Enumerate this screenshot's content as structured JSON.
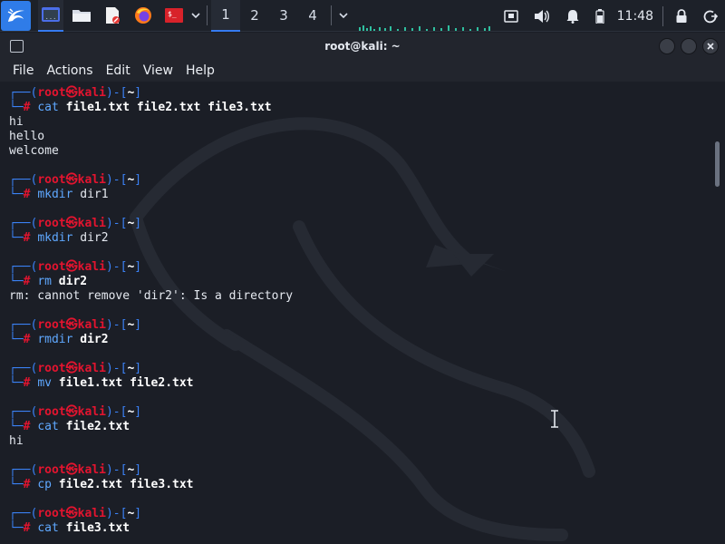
{
  "panel": {
    "workspaces": [
      "1",
      "2",
      "3",
      "4"
    ],
    "active_workspace": "1",
    "clock": "11:48",
    "launchers": [
      "kali-menu-icon",
      "terminal-icon",
      "file-manager-icon",
      "text-editor-icon",
      "firefox-icon",
      "terminal-emulator-icon"
    ],
    "tray_icons": [
      "network-icon",
      "volume-icon",
      "notification-bell-icon",
      "battery-icon",
      "lock-icon",
      "logout-icon"
    ]
  },
  "window": {
    "title": "root@kali: ~",
    "menus": [
      "File",
      "Actions",
      "Edit",
      "View",
      "Help"
    ]
  },
  "prompt": {
    "top_left": "┌──(",
    "user": "root",
    "skull": "㉿",
    "host": "kali",
    "mid": ")-[",
    "path": "~",
    "end": "]",
    "bottom_left": "└─",
    "hash": "#"
  },
  "terminal": {
    "blocks": [
      {
        "cmd": "cat",
        "args": "file1.txt file2.txt file3.txt",
        "bold_args": true,
        "output": [
          "hi",
          "hello",
          "welcome"
        ]
      },
      {
        "cmd": "mkdir",
        "args": "dir1",
        "bold_args": false,
        "output": []
      },
      {
        "cmd": "mkdir",
        "args": "dir2",
        "bold_args": false,
        "output": []
      },
      {
        "cmd": "rm",
        "args": "dir2",
        "bold_args": true,
        "output": [
          "rm: cannot remove 'dir2': Is a directory"
        ]
      },
      {
        "cmd": "rmdir",
        "args": "dir2",
        "bold_args": true,
        "output": []
      },
      {
        "cmd": "mv",
        "args": "file1.txt file2.txt",
        "bold_args": true,
        "output": []
      },
      {
        "cmd": "cat",
        "args": "file2.txt",
        "bold_args": true,
        "output": [
          "hi"
        ]
      },
      {
        "cmd": "cp",
        "args": "file2.txt file3.txt",
        "bold_args": true,
        "output": []
      },
      {
        "cmd": "cat",
        "args": "file3.txt",
        "bold_args": true,
        "output": []
      }
    ]
  },
  "colors": {
    "accent": "#367bf0",
    "prompt_frame": "#3b82f6",
    "prompt_user": "#e3142f",
    "command": "#5fa8ff",
    "background": "#1b1e26"
  }
}
